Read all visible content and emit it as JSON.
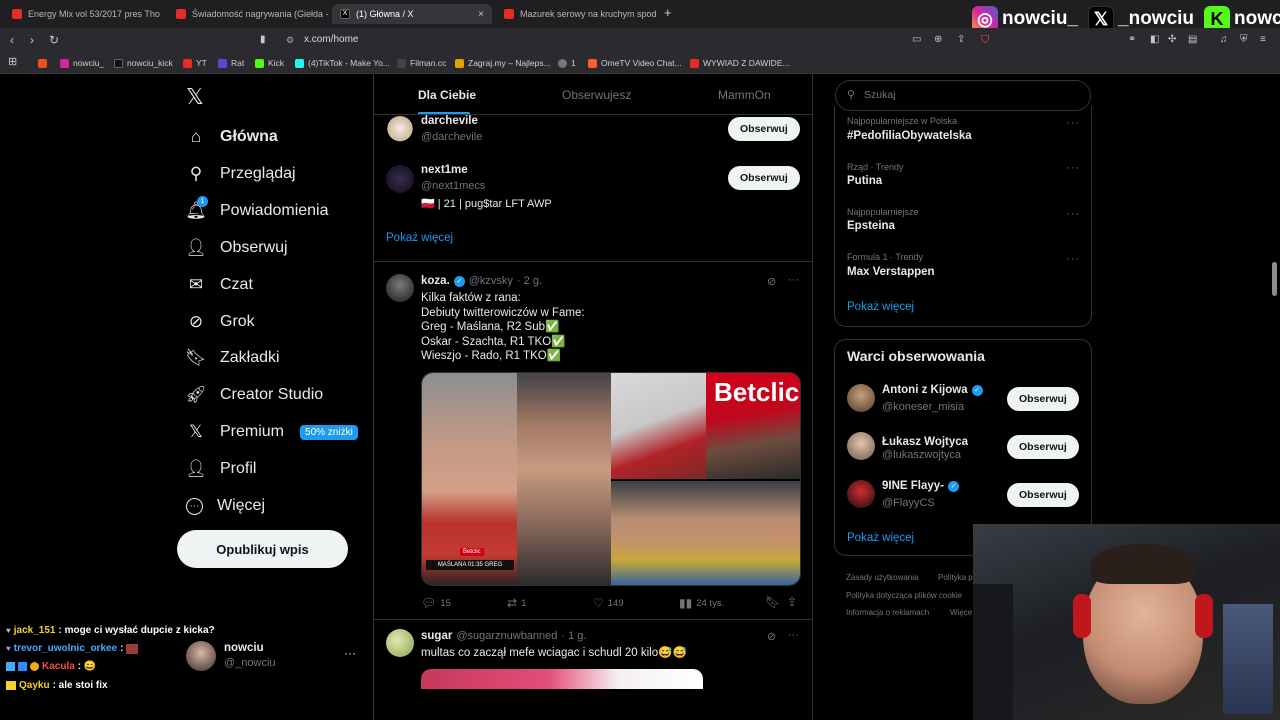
{
  "browser": {
    "tabs": [
      {
        "title": "Energy Mix vol 53/2017 pres Tho",
        "color": "#e52d27"
      },
      {
        "title": "Świadomość nagrywania (Giełda - Od",
        "color": "#e52d27"
      },
      {
        "title": "(1) Główna / X",
        "color": "#000000",
        "close": "×"
      },
      {
        "title": "Mazurek serowy na kruchym spodzie",
        "color": "#e52d27"
      }
    ],
    "new_tab": "+",
    "url": "x.com/home",
    "bookmarks": [
      {
        "label": "",
        "color": "#e8501e"
      },
      {
        "label": "nowciu_",
        "color": "#d6249f"
      },
      {
        "label": "nowciu_kick",
        "color": "#111111"
      },
      {
        "label": "YT",
        "color": "#e52d27"
      },
      {
        "label": "Rat",
        "color": "#6a3fd6"
      },
      {
        "label": "Kick",
        "color": "#53fc18"
      },
      {
        "label": "(4)TikTok - Make Yo...",
        "color": "#25f4ee"
      },
      {
        "label": "Filman.cc",
        "color": "#444444"
      },
      {
        "label": "Zagraj.my – Najleps...",
        "color": "#e0a400"
      },
      {
        "label": "1",
        "color": "#777777"
      },
      {
        "label": "OmeTV Video Chat...",
        "color": "#ff5a36"
      },
      {
        "label": "WYWIAD Z DAWIDE...",
        "color": "#e52d27"
      }
    ]
  },
  "overlay": {
    "socials": [
      {
        "icon": "instagram-icon",
        "glyph": "◎",
        "name": "nowciu_",
        "color": "#d6249f"
      },
      {
        "icon": "x-icon",
        "glyph": "𝕏",
        "name": "_nowciu",
        "color": "#000000"
      },
      {
        "icon": "kick-icon",
        "glyph": "K",
        "name": "nowciu",
        "color": "#53fc18"
      }
    ],
    "chat": [
      {
        "user": "jack_151",
        "color": "#f2d22e",
        "message": ": moge ci wysłać dupcie z kicka?"
      },
      {
        "user": "trevor_uwolnic_orkee",
        "color": "#4aa8ff",
        "message": ":"
      },
      {
        "user": "Kacula",
        "color": "#ff4a4a",
        "message": ": 😄"
      },
      {
        "user": "Qayku",
        "color": "#f2d22e",
        "message": ": ale stoi fix"
      }
    ]
  },
  "nav": {
    "logo": "𝕏",
    "items": [
      {
        "label": "Główna",
        "icon": "home-icon",
        "glyph": "⌂"
      },
      {
        "label": "Przeglądaj",
        "icon": "search-icon",
        "glyph": "⚲"
      },
      {
        "label": "Powiadomienia",
        "icon": "bell-icon",
        "glyph": "🔔︎",
        "badge": "1"
      },
      {
        "label": "Obserwuj",
        "icon": "follow-icon",
        "glyph": "👤︎"
      },
      {
        "label": "Czat",
        "icon": "mail-icon",
        "glyph": "✉"
      },
      {
        "label": "Grok",
        "icon": "grok-icon",
        "glyph": "⊘"
      },
      {
        "label": "Zakładki",
        "icon": "bookmark-icon",
        "glyph": "🔖︎"
      },
      {
        "label": "Creator Studio",
        "icon": "rocket-icon",
        "glyph": "🚀︎"
      },
      {
        "label": "Premium",
        "icon": "x-icon",
        "glyph": "𝕏",
        "badge": "50% zniżki"
      },
      {
        "label": "Profil",
        "icon": "profile-icon",
        "glyph": "👤︎"
      },
      {
        "label": "Więcej",
        "icon": "more-icon",
        "glyph": "⋯"
      }
    ],
    "post_button": "Opublikuj wpis",
    "account": {
      "name": "nowciu",
      "handle": "@_nowciu",
      "more": "···"
    }
  },
  "feed": {
    "tabs": [
      "Dla Ciebie",
      "Obserwujesz",
      "MammOn"
    ],
    "suggestions": [
      {
        "name": "darchevile",
        "handle": "@darchevile",
        "button": "Obserwuj"
      },
      {
        "name": "next1me",
        "handle": "@next1mecs",
        "bio": "🇵🇱 | 21 | pug$tar LFT AWP",
        "button": "Obserwuj"
      }
    ],
    "show_more": "Pokaż więcej",
    "tweets": [
      {
        "name": "koza.",
        "handle": "@kzvsky",
        "time": "· 2 g.",
        "lines": [
          "Kilka faktów z rana:",
          "Debiuty twitterowiczów w Fame:",
          "Greg - Maślana, R2 Sub✅",
          "Oskar - Szachta, R1 TKO✅",
          "Wieszjo - Rado, R1 TKO✅"
        ],
        "replies": "15",
        "reposts": "1",
        "likes": "149",
        "views": "24 tys.",
        "image_caption": "MAŚLANA 01:35 GREG",
        "brand": "Betclic"
      },
      {
        "name": "sugar",
        "handle": "@sugarznuwbanned",
        "time": "· 1 g.",
        "lines": [
          "multas co zaczął mefe wciagac i schudl 20 kilo😅😅"
        ]
      }
    ]
  },
  "sidebar": {
    "search_placeholder": "Szukaj",
    "trends": [
      {
        "meta": "Najpopularniejsze w Polska",
        "name": "#PedofiliaObywatelska"
      },
      {
        "meta": "Rząd · Trendy",
        "name": "Putina"
      },
      {
        "meta": "Najpopularniejsze",
        "name": "Epsteina"
      },
      {
        "meta": "Formula 1 · Trendy",
        "name": "Max Verstappen"
      }
    ],
    "trends_more": "Pokaż więcej",
    "who_to_follow": {
      "title": "Warci obserwowania",
      "accounts": [
        {
          "name": "Antoni z Kijowa",
          "handle": "@koneser_misia",
          "verified": true,
          "button": "Obserwuj"
        },
        {
          "name": "Łukasz Wojtyca",
          "handle": "@lukaszwojtyca",
          "verified": false,
          "button": "Obserwuj"
        },
        {
          "name": "9INE Flayy-",
          "handle": "@FlayyCS",
          "verified": true,
          "button": "Obserwuj"
        }
      ],
      "more": "Pokaż więcej"
    },
    "footer": [
      "Zasady użytkowania",
      "Polityka p",
      "Polityka dotycząca plików cookie",
      "Informacja o reklamach",
      "Więce"
    ]
  }
}
